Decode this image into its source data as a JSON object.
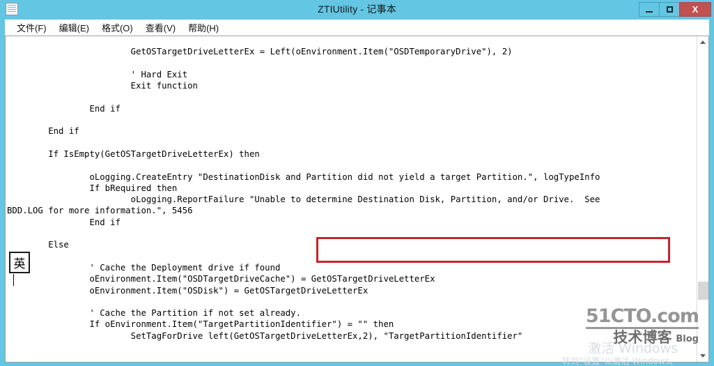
{
  "window": {
    "title": "ZTIUtility - 记事本",
    "icon": "notepad-icon",
    "buttons": {
      "minimize": "—",
      "maximize": "□",
      "close": "X"
    }
  },
  "menubar": {
    "items": [
      {
        "label": "文件(F)",
        "name": "menu-file"
      },
      {
        "label": "编辑(E)",
        "name": "menu-edit"
      },
      {
        "label": "格式(O)",
        "name": "menu-format"
      },
      {
        "label": "查看(V)",
        "name": "menu-view"
      },
      {
        "label": "帮助(H)",
        "name": "menu-help"
      }
    ]
  },
  "editor": {
    "content": "                        GetOSTargetDriveLetterEx = Left(oEnvironment.Item(\"OSDTemporaryDrive\"), 2)\n\n                        ' Hard Exit\n                        Exit function\n\n                End if\n\n        End if\n\n        If IsEmpty(GetOSTargetDriveLetterEx) then\n\n                oLogging.CreateEntry \"DestinationDisk and Partition did not yield a target Partition.\", logTypeInfo\n                If bRequired then\n                        oLogging.ReportFailure \"Unable to determine Destination Disk, Partition, and/or Drive.  See\nBDD.LOG for more information.\", 5456\n                End if\n\n        Else\n\n                ' Cache the Deployment drive if found\n                oEnvironment.Item(\"OSDTargetDriveCache\") = GetOSTargetDriveLetterEx\n                oEnvironment.Item(\"OSDisk\") = GetOSTargetDriveLetterEx\n\n                ' Cache the Partition if not set already.\n                If oEnvironment.Item(\"TargetPartitionIdentifier\") = \"\" then\n                        SetTagForDrive left(GetOSTargetDriveLetterEx,2), \"TargetPartitionIdentifier\"",
    "highlight": {
      "text": "\"Unable to determine Destination Disk, Partition, and/or Drive.",
      "color": "#c1272d"
    },
    "scrollbar": {
      "up_arrow": "▲",
      "down_arrow": "▼"
    }
  },
  "ime": {
    "indicator": "英"
  },
  "watermark": {
    "site": "51CTO.com",
    "cn": "技术博客",
    "blog": "Blog",
    "activate_line1": "激活 Windows",
    "activate_line2": "转到“设置”以激活 Windows。"
  },
  "colors": {
    "titlebar": "#63c6e3",
    "close_button": "#bf5150",
    "highlight": "#c1272d"
  }
}
